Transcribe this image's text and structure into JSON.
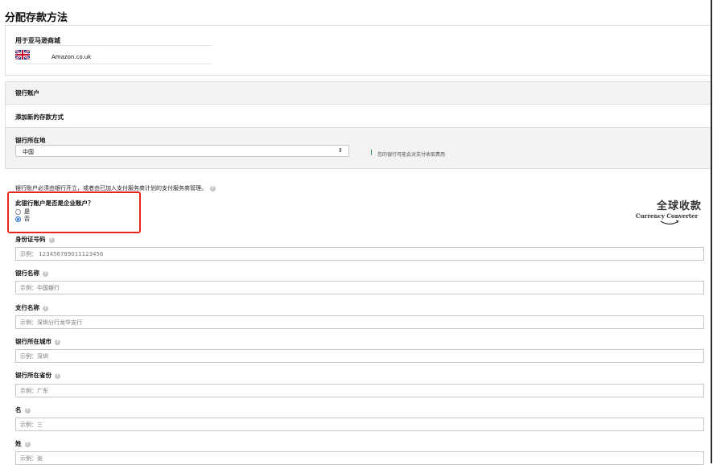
{
  "page": {
    "title": "分配存款方法"
  },
  "store": {
    "label": "用于亚马逊商城",
    "name": "Amazon.co.uk",
    "flag_icon": "uk-flag-icon"
  },
  "bank": {
    "header": "银行账户",
    "add_method": "添加新的存款方式",
    "location_label": "银行所在地",
    "location_value": "中国",
    "location_hint": "您的银行可能会对支付收取费用",
    "note": "银行账户必须由银行开立，或者由已加入支付服务商计划的支付服务商管理。"
  },
  "business": {
    "question": "此银行账户是否是企业账户？",
    "options": [
      "是",
      "否"
    ],
    "selected_index": 1
  },
  "logo": {
    "cn": "全球收款",
    "en": "Currency Converter"
  },
  "fields": [
    {
      "label": "身份证号码",
      "placeholder": "示例： 123456789011123456"
    },
    {
      "label": "银行名称",
      "placeholder": "示例：中国银行"
    },
    {
      "label": "支行名称",
      "placeholder": "示例：深圳分行龙华支行"
    },
    {
      "label": "银行所在城市",
      "placeholder": "示例：深圳"
    },
    {
      "label": "银行所在省份",
      "placeholder": "示例：广东"
    },
    {
      "label": "名",
      "placeholder": "示例：三"
    },
    {
      "label": "姓",
      "placeholder": "示例：张"
    }
  ],
  "colors": {
    "highlight": "#e4271c",
    "accent": "#2a6fdb",
    "info": "#2a9d5c"
  }
}
